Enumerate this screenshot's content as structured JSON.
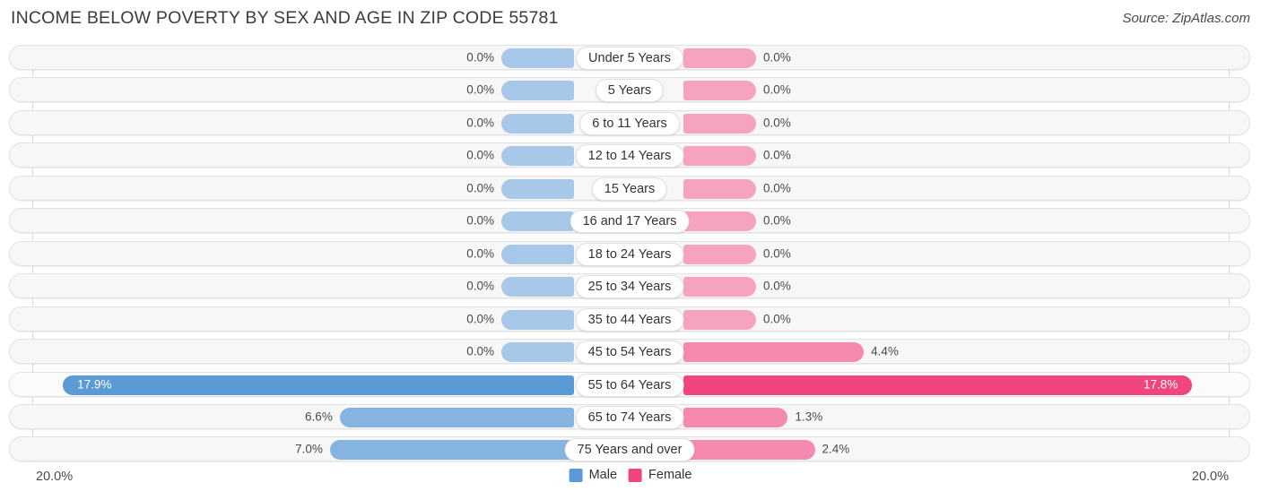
{
  "header": {
    "title": "INCOME BELOW POVERTY BY SEX AND AGE IN ZIP CODE 55781",
    "source": "Source: ZipAtlas.com"
  },
  "axis": {
    "left_label": "20.0%",
    "right_label": "20.0%",
    "max": 20.0
  },
  "legend": {
    "items": [
      {
        "label": "Male",
        "color": "#5b9bd5",
        "icon": "male-swatch"
      },
      {
        "label": "Female",
        "color": "#f0457f",
        "icon": "female-swatch"
      }
    ]
  },
  "chart_data": {
    "type": "bar",
    "subtype": "diverging-population-pyramid",
    "title": "INCOME BELOW POVERTY BY SEX AND AGE IN ZIP CODE 55781",
    "xlabel": "",
    "ylabel": "",
    "xlim": [
      -20.0,
      20.0
    ],
    "unit": "%",
    "grid": true,
    "legend_position": "bottom-center",
    "categories": [
      "Under 5 Years",
      "5 Years",
      "6 to 11 Years",
      "12 to 14 Years",
      "15 Years",
      "16 and 17 Years",
      "18 to 24 Years",
      "25 to 34 Years",
      "35 to 44 Years",
      "45 to 54 Years",
      "55 to 64 Years",
      "65 to 74 Years",
      "75 Years and over"
    ],
    "series": [
      {
        "name": "Male",
        "color": "#5b9bd5",
        "values": [
          0.0,
          0.0,
          0.0,
          0.0,
          0.0,
          0.0,
          0.0,
          0.0,
          0.0,
          0.0,
          17.9,
          6.6,
          7.0
        ],
        "labels": [
          "0.0%",
          "0.0%",
          "0.0%",
          "0.0%",
          "0.0%",
          "0.0%",
          "0.0%",
          "0.0%",
          "0.0%",
          "0.0%",
          "17.9%",
          "6.6%",
          "7.0%"
        ]
      },
      {
        "name": "Female",
        "color": "#f0457f",
        "values": [
          0.0,
          0.0,
          0.0,
          0.0,
          0.0,
          0.0,
          0.0,
          0.0,
          0.0,
          4.4,
          17.8,
          1.3,
          2.4
        ],
        "labels": [
          "0.0%",
          "0.0%",
          "0.0%",
          "0.0%",
          "0.0%",
          "0.0%",
          "0.0%",
          "0.0%",
          "0.0%",
          "4.4%",
          "17.8%",
          "1.3%",
          "2.4%"
        ]
      }
    ],
    "highlighted_category": "55 to 64 Years"
  }
}
